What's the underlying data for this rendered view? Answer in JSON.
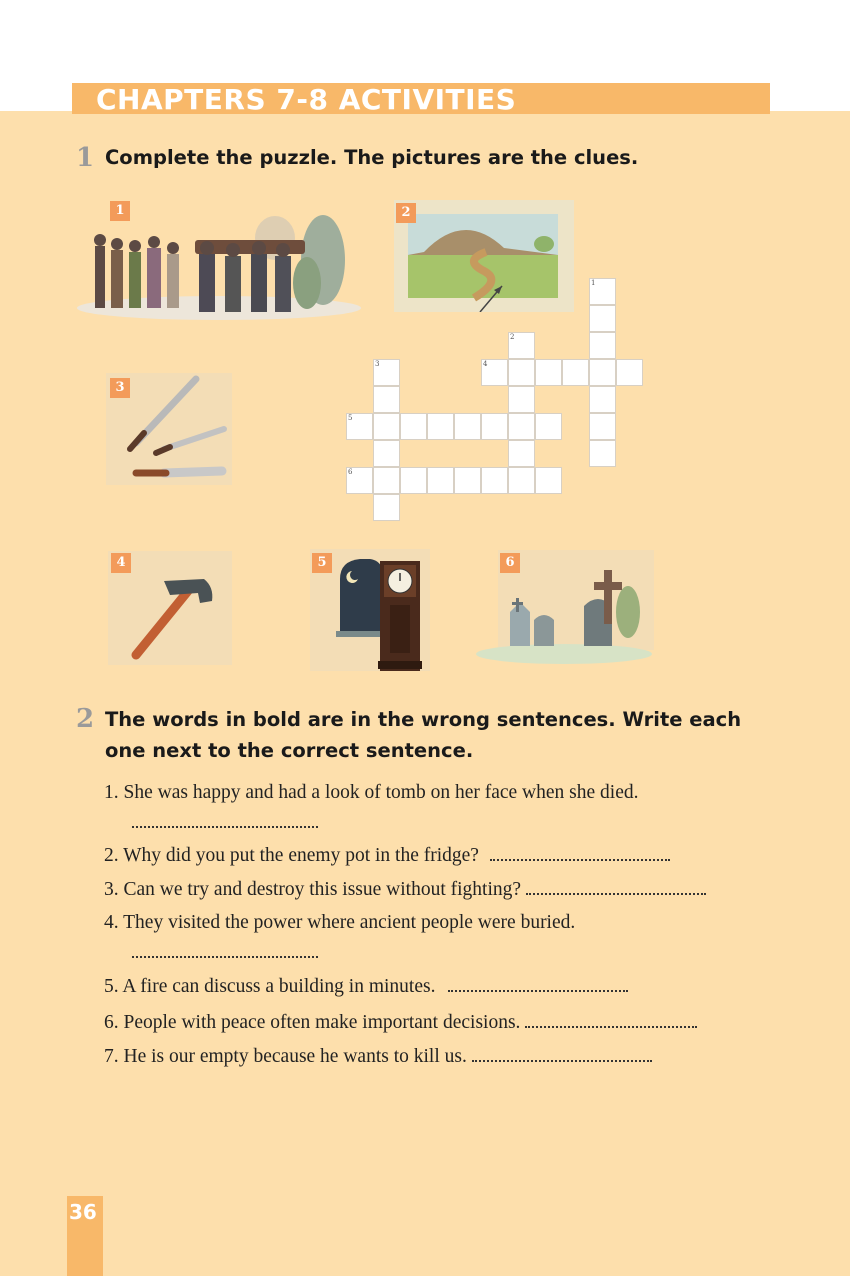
{
  "header": {
    "title": "CHAPTERS 7-8 ACTIVITIES"
  },
  "section1": {
    "number": "1",
    "instruction": "Complete the puzzle. The pictures are the clues.",
    "pictures": [
      {
        "badge": "1",
        "subject": "funeral procession carrying coffin"
      },
      {
        "badge": "2",
        "subject": "path through landscape"
      },
      {
        "badge": "3",
        "subject": "daggers"
      },
      {
        "badge": "4",
        "subject": "hammer"
      },
      {
        "badge": "5",
        "subject": "grandfather clock"
      },
      {
        "badge": "6",
        "subject": "graveyard"
      }
    ],
    "crossword_numbers": [
      "1",
      "2",
      "3",
      "4",
      "5",
      "6"
    ]
  },
  "section2": {
    "number": "2",
    "instruction_line1": "The words in bold are in the wrong sentences. Write each",
    "instruction_line2": "one next to the correct sentence.",
    "sentences": [
      "1. She was happy and had a look of tomb on her face when she died.",
      "2. Why did you put the enemy pot in the fridge?",
      "3. Can we try and destroy this issue without fighting?",
      "4. They visited the power where ancient people were buried.",
      "5. A fire can discuss a building in minutes.",
      "6. People with peace often make important decisions.",
      "7. He is our empty because he wants to kill us."
    ]
  },
  "footer": {
    "page_number": "36"
  },
  "colors": {
    "background": "#fddfac",
    "banner": "#f8b869",
    "badge": "#f39b5a"
  }
}
